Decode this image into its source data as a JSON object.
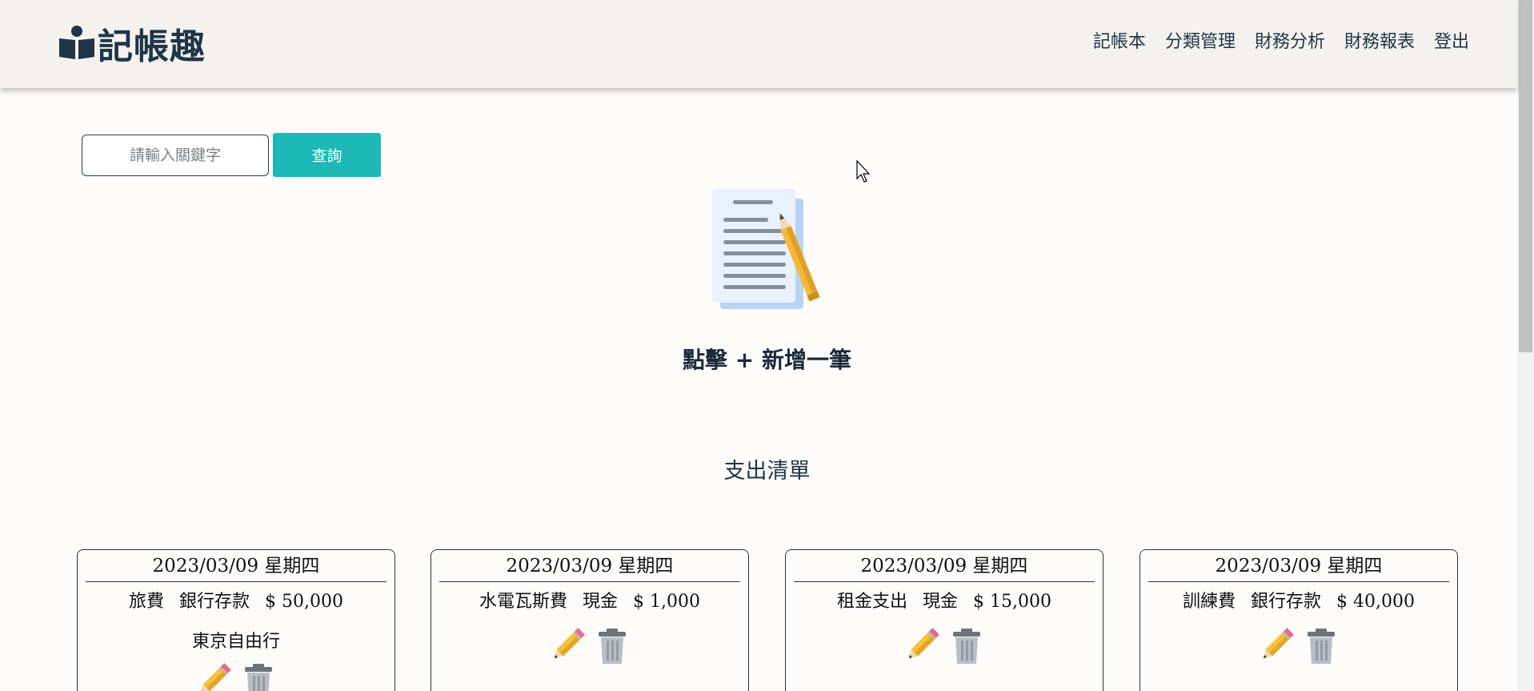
{
  "header": {
    "logo_text": "記帳趣",
    "nav": [
      "記帳本",
      "分類管理",
      "財務分析",
      "財務報表",
      "登出"
    ]
  },
  "search": {
    "placeholder": "請輸入關鍵字",
    "button_label": "查詢"
  },
  "add_entry": {
    "label": "點擊 + 新增一筆",
    "icon": "document-pencil-icon"
  },
  "section_title": "支出清單",
  "colors": {
    "accent": "#1cb8b6",
    "nav_text": "#1f3548",
    "navbar_bg": "#f4f2ee"
  },
  "records": [
    {
      "date": "2023/03/09 星期四",
      "category": "旅費",
      "account": "銀行存款",
      "amount": "$ 50,000",
      "note": "東京自由行"
    },
    {
      "date": "2023/03/09 星期四",
      "category": "水電瓦斯費",
      "account": "現金",
      "amount": "$ 1,000",
      "note": ""
    },
    {
      "date": "2023/03/09 星期四",
      "category": "租金支出",
      "account": "現金",
      "amount": "$ 15,000",
      "note": ""
    },
    {
      "date": "2023/03/09 星期四",
      "category": "訓練費",
      "account": "銀行存款",
      "amount": "$ 40,000",
      "note": ""
    }
  ]
}
